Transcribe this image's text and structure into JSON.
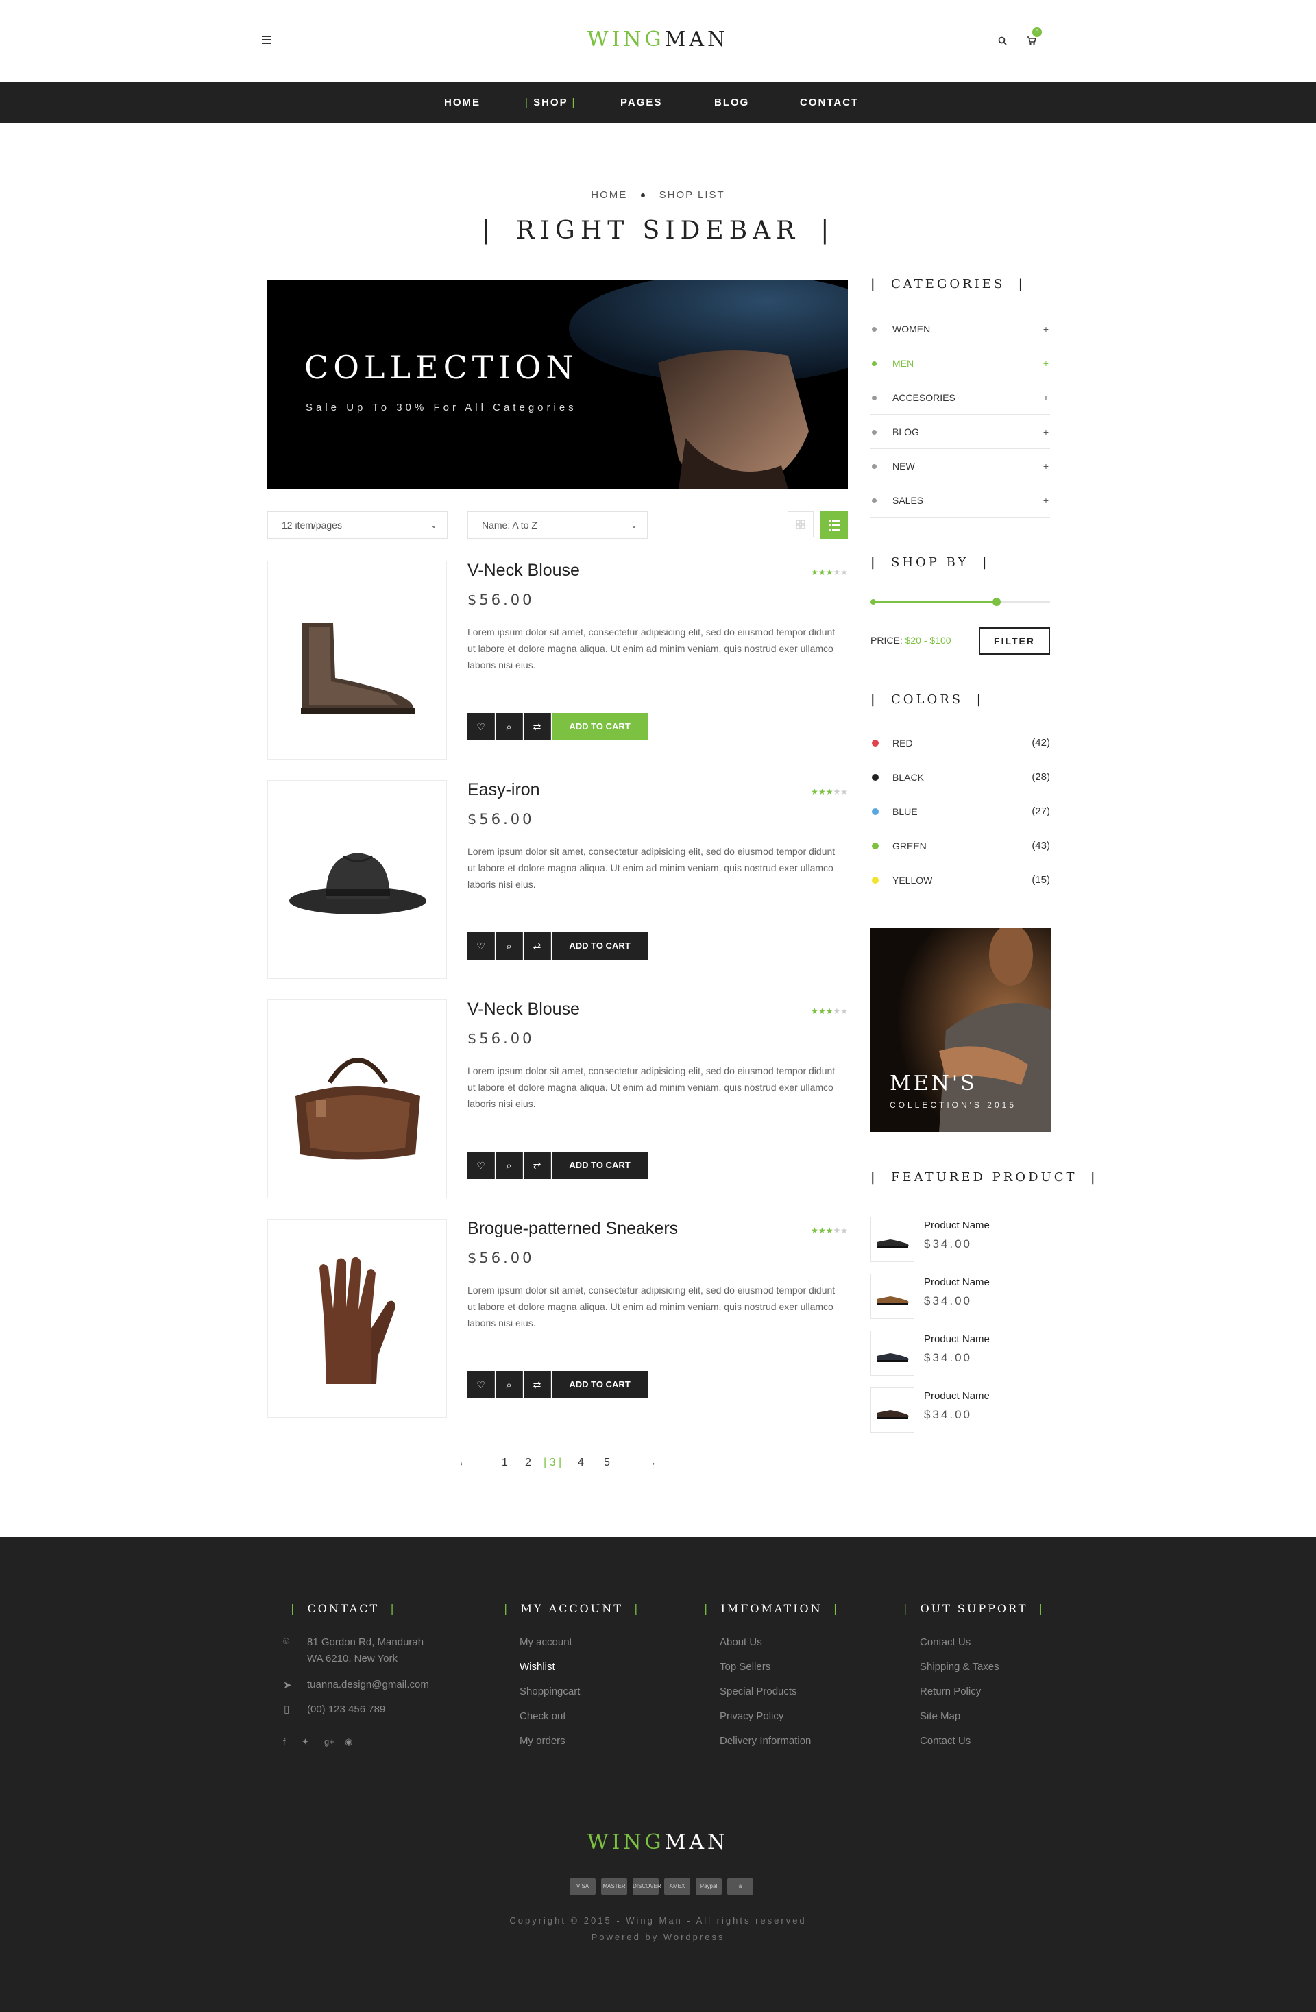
{
  "header": {
    "logo_part1": "WING",
    "logo_part2": "MAN",
    "cart_count": "0",
    "menu_icon": "hamburger-icon",
    "search_icon": "search-icon",
    "cart_icon": "cart-icon"
  },
  "nav": {
    "items": [
      "HOME",
      "SHOP",
      "PAGES",
      "BLOG",
      "CONTACT"
    ],
    "active": "SHOP"
  },
  "breadcrumb": {
    "home": "HOME",
    "current": "SHOP LIST"
  },
  "page_title": "RIGHT SIDEBAR",
  "banner": {
    "title": "COLLECTION",
    "subtitle": "Sale Up To 30% For All Categories"
  },
  "toolbar": {
    "per_page": "12 item/pages",
    "sort": "Name: A to Z",
    "grid_icon": "grid-view-icon",
    "list_icon": "list-view-icon"
  },
  "products": [
    {
      "name": "V-Neck Blouse",
      "price": "$56.00",
      "rating": 3,
      "description": "Lorem ipsum dolor sit amet, consectetur adipisicing elit, sed do eiusmod tempor didunt ut labore et dolore magna aliqua. Ut enim ad minim veniam, quis nostrud exer ullamco laboris nisi eius.",
      "cart_label": "ADD TO CART",
      "image": "boot"
    },
    {
      "name": "Easy-iron",
      "price": "$56.00",
      "rating": 3,
      "description": "Lorem ipsum dolor sit amet, consectetur adipisicing elit, sed do eiusmod tempor didunt ut labore et dolore magna aliqua. Ut enim ad minim veniam, quis nostrud exer ullamco laboris nisi eius.",
      "cart_label": "ADD TO CART",
      "image": "hat"
    },
    {
      "name": "V-Neck Blouse",
      "price": "$56.00",
      "rating": 3,
      "description": "Lorem ipsum dolor sit amet, consectetur adipisicing elit, sed do eiusmod tempor didunt ut labore et dolore magna aliqua. Ut enim ad minim veniam, quis nostrud exer ullamco laboris nisi eius.",
      "cart_label": "ADD TO CART",
      "image": "bag"
    },
    {
      "name": "Brogue-patterned Sneakers",
      "price": "$56.00",
      "rating": 3,
      "description": "Lorem ipsum dolor sit amet, consectetur adipisicing elit, sed do eiusmod tempor didunt ut labore et dolore magna aliqua. Ut enim ad minim veniam, quis nostrud exer ullamco laboris nisi eius.",
      "cart_label": "ADD TO CART",
      "image": "gloves"
    }
  ],
  "pagination": {
    "prev": "←",
    "next": "→",
    "pages": [
      "1",
      "2",
      "3",
      "4",
      "5"
    ],
    "current": "3"
  },
  "sidebar": {
    "categories_title": "CATEGORIES",
    "categories": [
      "WOMEN",
      "MEN",
      "ACCESORIES",
      "BLOG",
      "NEW",
      "SALES"
    ],
    "active_category": "MEN",
    "shopby_title": "SHOP BY",
    "price_label": "PRICE:",
    "price_range": "$20 - $100",
    "price_slider_min": 0,
    "price_slider_max": 0.7,
    "filter_label": "FILTER",
    "colors_title": "COLORS",
    "colors": [
      {
        "name": "RED",
        "count": "(42)",
        "hex": "#e2424b"
      },
      {
        "name": "BLACK",
        "count": "(28)",
        "hex": "#222222"
      },
      {
        "name": "BLUE",
        "count": "(27)",
        "hex": "#5aa7e0"
      },
      {
        "name": "GREEN",
        "count": "(43)",
        "hex": "#7cc142"
      },
      {
        "name": "YELLOW",
        "count": "(15)",
        "hex": "#f2e42a"
      }
    ],
    "promo_title": "MEN'S",
    "promo_subtitle": "COLLECTION'S 2015",
    "featured_title": "FEATURED PRODUCT",
    "featured": [
      {
        "name": "Product Name",
        "price": "$34.00"
      },
      {
        "name": "Product Name",
        "price": "$34.00"
      },
      {
        "name": "Product Name",
        "price": "$34.00"
      },
      {
        "name": "Product Name",
        "price": "$34.00"
      }
    ]
  },
  "footer": {
    "contact_title": "CONTACT",
    "address_line1": "81 Gordon Rd, Mandurah",
    "address_line2": "WA 6210, New York",
    "email": "tuanna.design@gmail.com",
    "phone": "(00) 123 456 789",
    "account_title": "MY ACCOUNT",
    "account_links": [
      "My account",
      "Wishlist",
      "Shoppingcart",
      "Check out",
      "My orders"
    ],
    "account_highlight": "Wishlist",
    "info_title": "IMFOMATION",
    "info_links": [
      "About Us",
      "Top Sellers",
      "Special Products",
      "Privacy Policy",
      "Delivery Information"
    ],
    "support_title": "OUT SUPPORT",
    "support_links": [
      "Contact Us",
      "Shipping & Taxes",
      "Return Policy",
      "Site Map",
      "Contact Us"
    ],
    "logo_part1": "WING",
    "logo_part2": "MAN",
    "payments": [
      "VISA",
      "MASTER",
      "DISCOVER",
      "AMEX",
      "Paypal",
      "a"
    ],
    "copyright": "Copyright © 2015 - Wing Man - All rights reserved",
    "powered": "Powered by Wordpress"
  },
  "colors": {
    "accent": "#7cc142",
    "dark": "#222222"
  }
}
